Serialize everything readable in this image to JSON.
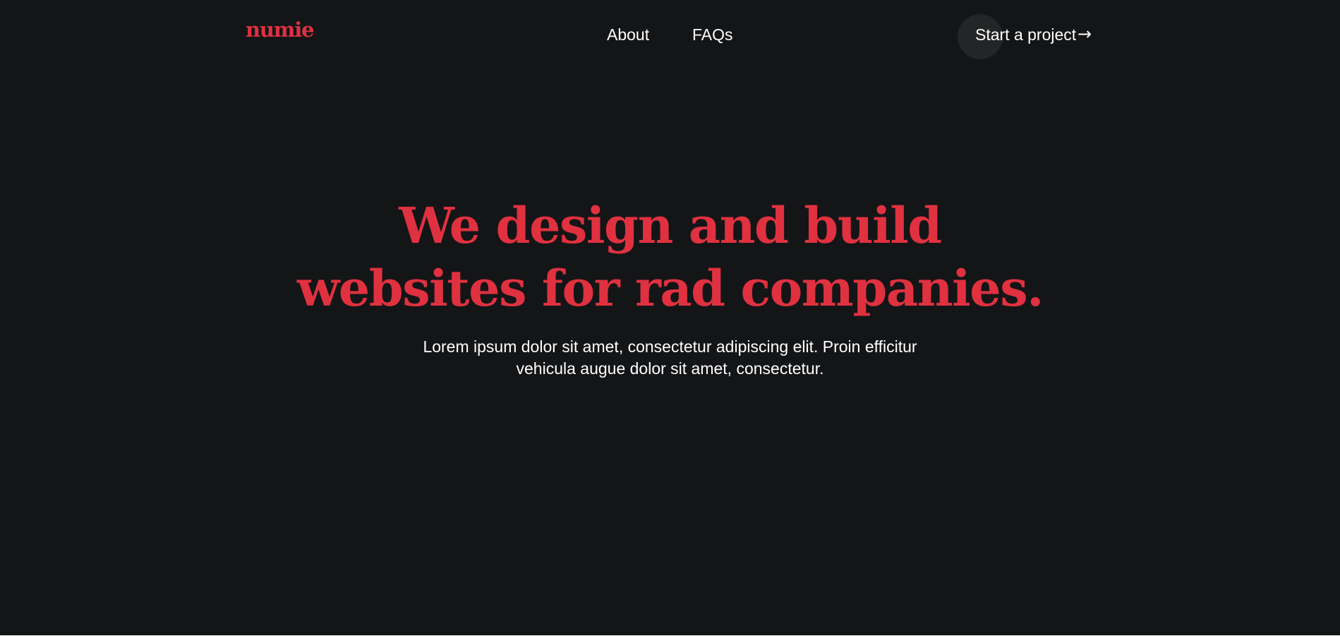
{
  "colors": {
    "background": "#141517",
    "accent": "#e03140",
    "text": "#ffffff",
    "button_circle": "#242526"
  },
  "header": {
    "logo": "numie",
    "nav": [
      {
        "label": "About"
      },
      {
        "label": "FAQs"
      }
    ],
    "cta_label": "Start a project",
    "cta_icon": "arrow-right-icon",
    "cta_arrow": "→"
  },
  "hero": {
    "title_line_1": "We design and build",
    "title_line_2": "websites for rad companies.",
    "subtitle_line_1": "Lorem ipsum dolor sit amet, consectetur adipiscing elit. Proin efficitur",
    "subtitle_line_2": "vehicula augue dolor sit amet, consectetur."
  }
}
